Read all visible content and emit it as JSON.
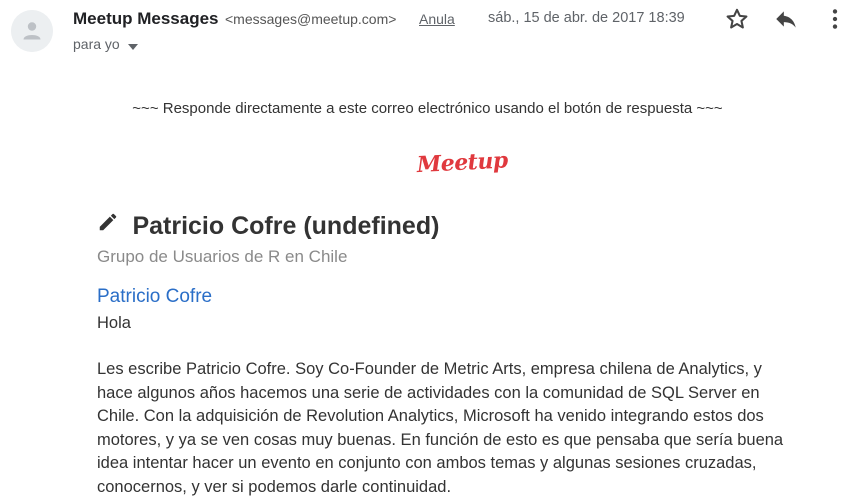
{
  "header": {
    "sender_name": "Meetup Messages",
    "sender_email": "<messages@meetup.com>",
    "unsubscribe": "Anula",
    "date": "sáb., 15 de abr. de 2017 18:39",
    "to_line": "para yo",
    "icons": {
      "avatar": "person-avatar-icon",
      "star": "star-icon",
      "reply": "reply-icon",
      "more": "more-vert-icon",
      "to_dropdown": "dropdown-arrow-icon"
    }
  },
  "email": {
    "reply_banner": "~~~ Responde directamente a este correo electrónico usando el botón de respuesta ~~~",
    "logo_text": "Meetup",
    "logo_color": "#e0393e",
    "title": "Patricio Cofre (undefined)",
    "group": "Grupo de Usuarios de R en Chile",
    "author": "Patricio Cofre",
    "greeting": "Hola",
    "body_lines": [
      "Les escribe Patricio Cofre. Soy Co-Founder de Metric Arts, empresa chilena de Analytics, y",
      "hace algunos años hacemos una serie de actividades con la comunidad de SQL Server en",
      "Chile. Con la adquisición de Revolution Analytics, Microsoft ha venido integrando estos dos",
      "motores, y ya se ven cosas muy buenas. En función de esto es que pensaba que sería buena",
      "idea intentar hacer un evento en conjunto con ambos temas y algunas sesiones cruzadas,",
      "conocernos, y ver si podemos darle continuidad."
    ]
  }
}
